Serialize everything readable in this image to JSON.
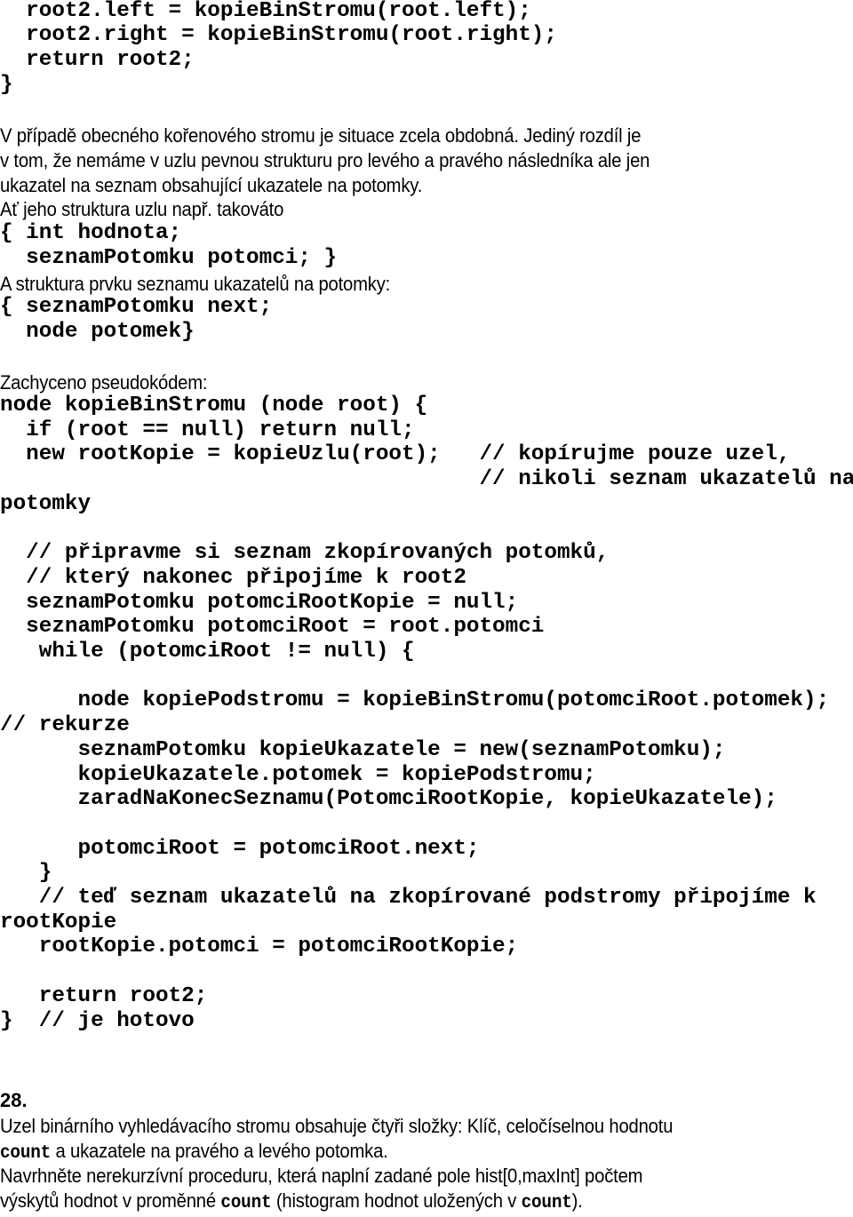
{
  "code_top": [
    "  root2.left = kopieBinStromu(root.left);",
    "  root2.right = kopieBinStromu(root.right);",
    "  return root2;",
    "}"
  ],
  "paragraph_general_tree": [
    "V případě obecného kořenového stromu je situace zcela obdobná. Jediný rozdíl je",
    "v tom, že nemáme v uzlu pevnou strukturu pro levého a pravého následníka ale jen",
    "ukazatel na seznam obsahující ukazatele na potomky.",
    "Ať jeho struktura uzlu např. takováto"
  ],
  "node_struct": [
    "{ int hodnota;",
    "  seznamPotomku potomci; }"
  ],
  "list_struct_intro": "A struktura prvku seznamu ukazatelů na potomky:",
  "list_struct": [
    "{ seznamPotomku next;",
    "  node potomek}"
  ],
  "pseudocode_intro": "Zachyceno pseudokódem:",
  "pseudocode": [
    "node kopieBinStromu (node root) {",
    "  if (root == null) return null;",
    "  new rootKopie = kopieUzlu(root);   // kopírujme pouze uzel,",
    "                                     // nikoli seznam ukazatelů na",
    "potomky",
    "",
    "  // připravme si seznam zkopírovaných potomků,",
    "  // který nakonec připojíme k root2",
    "  seznamPotomku potomciRootKopie = null;",
    "  seznamPotomku potomciRoot = root.potomci",
    "   while (potomciRoot != null) {",
    "",
    "      node kopiePodstromu = kopieBinStromu(potomciRoot.potomek);",
    "// rekurze",
    "      seznamPotomku kopieUkazatele = new(seznamPotomku);",
    "      kopieUkazatele.potomek = kopiePodstromu;",
    "      zaradNaKonecSeznamu(PotomciRootKopie, kopieUkazatele);",
    "",
    "      potomciRoot = potomciRoot.next;",
    "   }",
    "   // teď seznam ukazatelů na zkopírované podstromy připojíme k",
    "rootKopie",
    "   rootKopie.potomci = potomciRootKopie;",
    "",
    "   return root2;",
    "}  // je hotovo"
  ],
  "task": {
    "number": "28.",
    "line1": "Uzel binárního vyhledávacího stromu obsahuje čtyři složky: Klíč, celočíselnou hodnotu",
    "line2_code": "count",
    "line2_rest": " a ukazatele na pravého a levého potomka.",
    "line3": "Navrhněte nerekurzívní proceduru, která naplní zadané pole hist[0,maxInt] počtem",
    "line4_a": "výskytů hodnot v proměnné ",
    "line4_code1": "count",
    "line4_b": " (histogram hodnot uložených v ",
    "line4_code2": "count",
    "line4_c": ")."
  }
}
